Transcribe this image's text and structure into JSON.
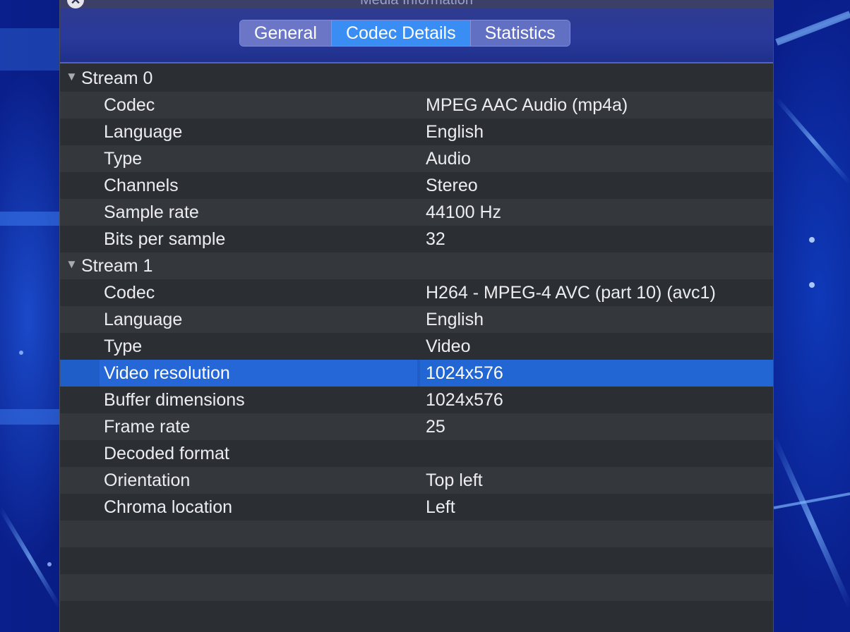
{
  "window": {
    "title": "Media Information",
    "close_symbol": "✕"
  },
  "tabs": [
    {
      "label": "General",
      "active": false
    },
    {
      "label": "Codec Details",
      "active": true
    },
    {
      "label": "Statistics",
      "active": false
    }
  ],
  "streams": [
    {
      "label": "Stream 0",
      "expanded": true,
      "properties": [
        {
          "key": "Codec",
          "value": "MPEG AAC Audio (mp4a)"
        },
        {
          "key": "Language",
          "value": "English"
        },
        {
          "key": "Type",
          "value": "Audio"
        },
        {
          "key": "Channels",
          "value": "Stereo"
        },
        {
          "key": "Sample rate",
          "value": "44100 Hz"
        },
        {
          "key": "Bits per sample",
          "value": "32"
        }
      ]
    },
    {
      "label": "Stream 1",
      "expanded": true,
      "properties": [
        {
          "key": "Codec",
          "value": "H264 - MPEG-4 AVC (part 10) (avc1)"
        },
        {
          "key": "Language",
          "value": "English"
        },
        {
          "key": "Type",
          "value": "Video"
        },
        {
          "key": "Video resolution",
          "value": "1024x576",
          "selected": true
        },
        {
          "key": "Buffer dimensions",
          "value": "1024x576"
        },
        {
          "key": "Frame rate",
          "value": "25"
        },
        {
          "key": "Decoded format",
          "value": ""
        },
        {
          "key": "Orientation",
          "value": "Top left"
        },
        {
          "key": "Chroma location",
          "value": "Left"
        }
      ]
    }
  ],
  "icons": {
    "disclosure": "disclosure-triangle-down-icon",
    "close": "close-icon"
  },
  "colors": {
    "selection": "#1f5dc8",
    "active_tab": "#3a8ef3",
    "panel_bg": "#2b2e33"
  }
}
